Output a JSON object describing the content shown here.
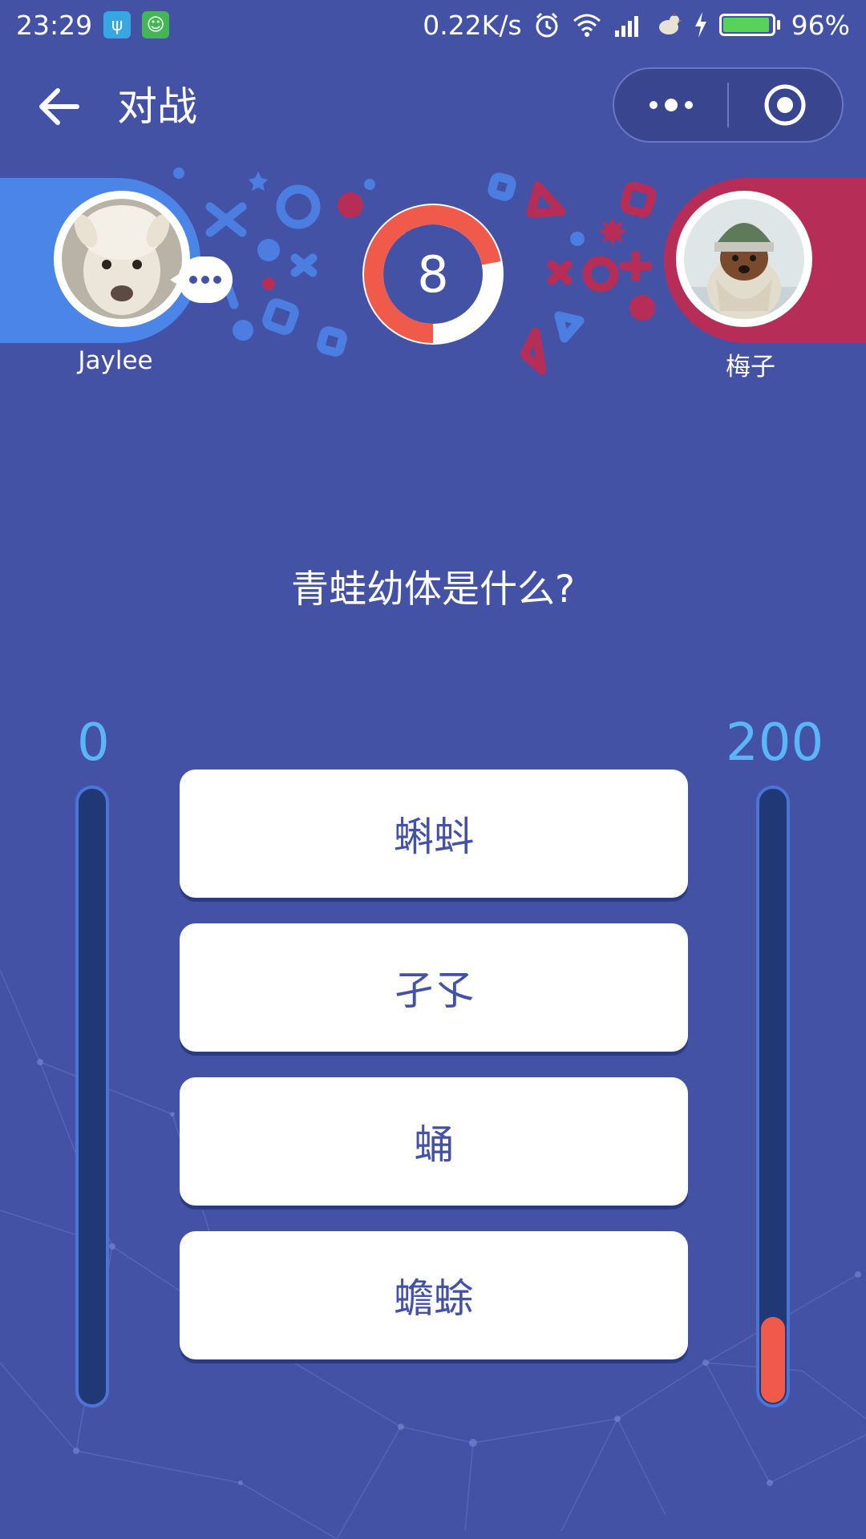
{
  "status_bar": {
    "time": "23:29",
    "net_speed": "0.22K/s",
    "battery": "96%",
    "battery_level": 0.96,
    "icons": [
      "usb-icon",
      "android-icon",
      "alarm-icon",
      "wifi-icon",
      "signal-icon",
      "bird-icon",
      "charging-icon",
      "battery-icon"
    ]
  },
  "header": {
    "title": "对战",
    "back_icon": "arrow-left-icon",
    "more_icon": "more-dots-icon",
    "close_icon": "target-icon"
  },
  "battle": {
    "player_left": {
      "name": "Jaylee"
    },
    "player_right": {
      "name": "梅子"
    },
    "timer": {
      "value": "8",
      "progress": 0.72
    }
  },
  "question": "青蛙幼体是什么?",
  "scores": {
    "left": "0",
    "right": "200",
    "left_fraction": 0.0,
    "right_fraction": 0.14
  },
  "options": [
    {
      "label": "蝌蚪"
    },
    {
      "label": "孑孓"
    },
    {
      "label": "蛹"
    },
    {
      "label": "蟾蜍"
    }
  ],
  "colors": {
    "background": "#4452a6",
    "player_left": "#4b85e8",
    "player_right": "#b62e58",
    "accent_red": "#ef5a4a",
    "score": "#5ab6f7"
  }
}
